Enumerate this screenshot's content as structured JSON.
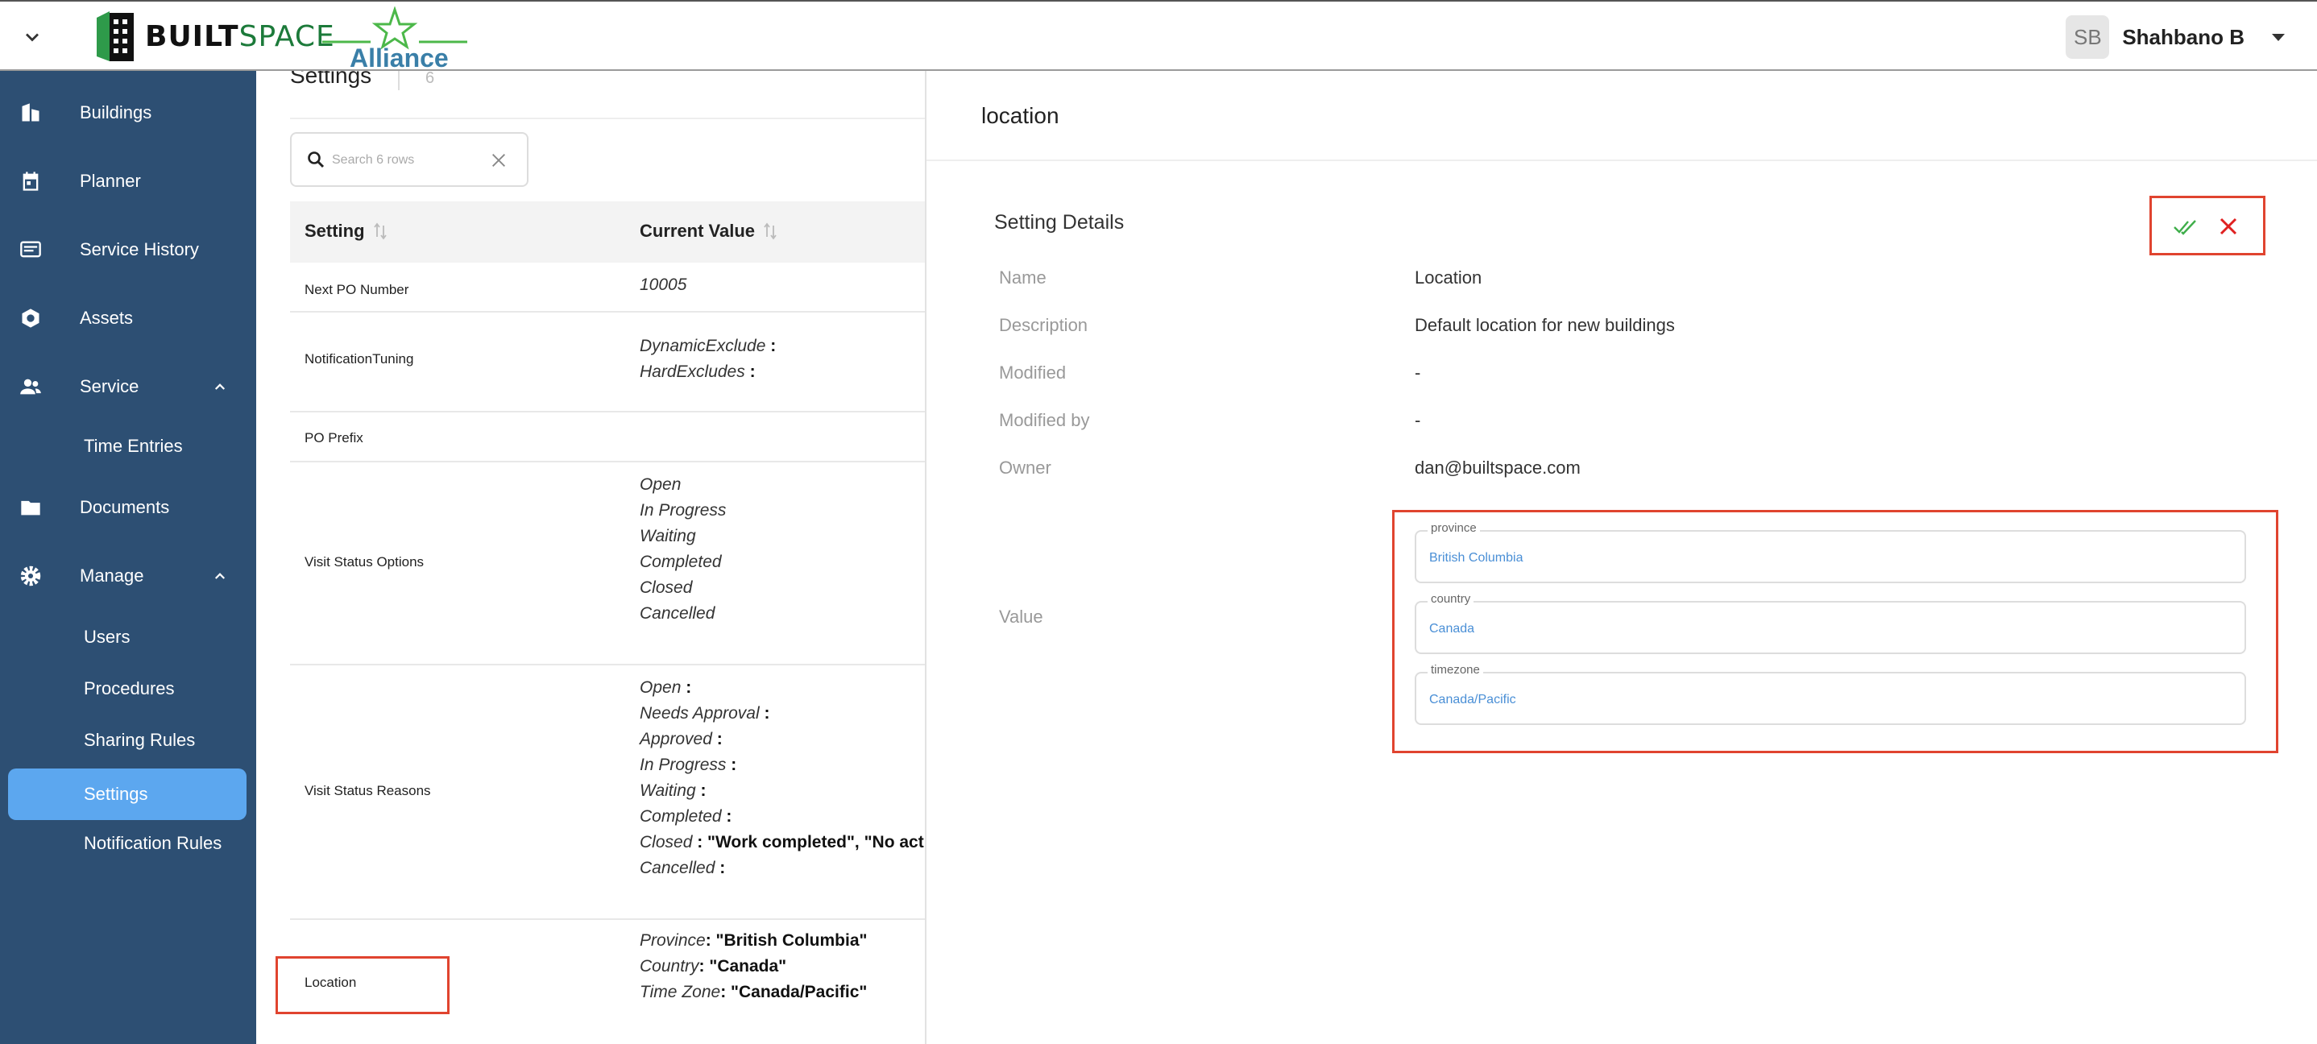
{
  "header": {
    "logo_built": "BUILT",
    "logo_space": "SPACE",
    "alliance": "Alliance",
    "user_initials": "SB",
    "user_name": "Shahbano B"
  },
  "sidebar": {
    "items": [
      {
        "label": "Buildings",
        "icon": "building-icon"
      },
      {
        "label": "Planner",
        "icon": "calendar-icon"
      },
      {
        "label": "Service History",
        "icon": "list-icon"
      },
      {
        "label": "Assets",
        "icon": "hexagon-icon"
      },
      {
        "label": "Service",
        "icon": "people-icon",
        "expanded": true
      },
      {
        "label": "Time Entries"
      },
      {
        "label": "Documents",
        "icon": "folder-icon"
      },
      {
        "label": "Manage",
        "icon": "gear-icon",
        "expanded": true
      },
      {
        "label": "Users"
      },
      {
        "label": "Procedures"
      },
      {
        "label": "Sharing Rules"
      },
      {
        "label": "Settings",
        "active": true
      },
      {
        "label": "Notification Rules"
      }
    ]
  },
  "list": {
    "title": "Settings",
    "count": "6",
    "search_placeholder": "Search 6 rows",
    "col_setting": "Setting",
    "col_value": "Current Value",
    "rows": [
      {
        "name": "Next PO Number",
        "lines": [
          [
            "10005",
            ""
          ]
        ]
      },
      {
        "name": "NotificationTuning",
        "lines": [
          [
            "DynamicExclude",
            " :"
          ],
          [
            "HardExcludes",
            " :"
          ]
        ]
      },
      {
        "name": "PO Prefix",
        "lines": []
      },
      {
        "name": "Visit Status Options",
        "lines": [
          [
            "Open",
            ""
          ],
          [
            "In Progress",
            ""
          ],
          [
            "Waiting",
            ""
          ],
          [
            "Completed",
            ""
          ],
          [
            "Closed",
            ""
          ],
          [
            "Cancelled",
            ""
          ]
        ]
      },
      {
        "name": "Visit Status Reasons",
        "lines": [
          [
            "Open",
            " :"
          ],
          [
            "Needs Approval",
            " :"
          ],
          [
            "Approved",
            " :"
          ],
          [
            "In Progress",
            " :"
          ],
          [
            "Waiting",
            " :"
          ],
          [
            "Completed",
            " :"
          ],
          [
            "Closed",
            " : \"Work completed\", \"No acti"
          ],
          [
            "Cancelled",
            " :"
          ]
        ]
      },
      {
        "name": "Location",
        "lines": [
          [
            "Province",
            ": \"British Columbia\""
          ],
          [
            "Country",
            ": \"Canada\""
          ],
          [
            "Time Zone",
            ": \"Canada/Pacific\""
          ]
        ]
      }
    ]
  },
  "detail": {
    "title": "location",
    "section": "Setting Details",
    "fields": {
      "name_label": "Name",
      "name_value": "Location",
      "desc_label": "Description",
      "desc_value": "Default location for new buildings",
      "modified_label": "Modified",
      "modified_value": "-",
      "modifiedby_label": "Modified by",
      "modifiedby_value": "-",
      "owner_label": "Owner",
      "owner_value": "dan@builtspace.com",
      "value_label": "Value"
    },
    "value_inputs": {
      "province_label": "province",
      "province": "British Columbia",
      "country_label": "country",
      "country": "Canada",
      "timezone_label": "timezone",
      "timezone": "Canada/Pacific"
    }
  },
  "colors": {
    "sidebar_bg": "#2d4f73",
    "active_item": "#5ca7ef",
    "highlight": "#e0442f",
    "ok": "#3fae4a",
    "cancel": "#e02020"
  }
}
